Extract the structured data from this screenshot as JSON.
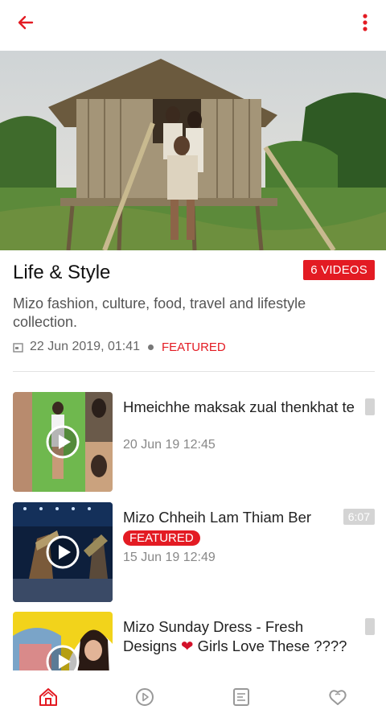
{
  "header": {
    "back_icon": "arrow-left-icon",
    "menu_icon": "more-vertical-icon",
    "accent": "#e31b23"
  },
  "playlist": {
    "title": "Life & Style",
    "count_badge": "6 VIDEOS",
    "description": "Mizo fashion, culture, food, travel and lifestyle collection.",
    "date": "22 Jun 2019, 01:41",
    "tag": "FEATURED"
  },
  "videos": [
    {
      "title": "Hmeichhe maksak zual thenkhat te",
      "date": "20 Jun 19 12:45",
      "duration": ""
    },
    {
      "title": "Mizo Chheih Lam Thiam Ber",
      "badge": "FEATURED",
      "date": "15 Jun 19 12:49",
      "duration": "6:07"
    },
    {
      "title_part1": "Mizo Sunday Dress - Fresh Designs ",
      "heart": "❤",
      "title_part2": " Girls Love These ????",
      "duration": ""
    }
  ],
  "bottom_nav": [
    {
      "name": "home-icon",
      "active": true
    },
    {
      "name": "play-circle-icon",
      "active": false
    },
    {
      "name": "document-icon",
      "active": false
    },
    {
      "name": "heart-chat-icon",
      "active": false
    }
  ]
}
